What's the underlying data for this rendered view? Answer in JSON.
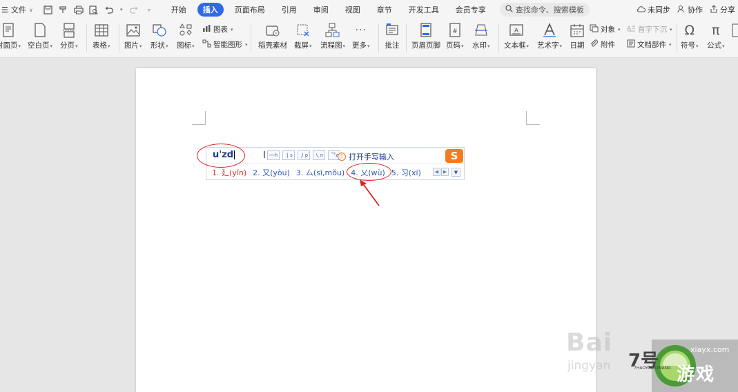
{
  "menubar": {
    "file_label": "文件",
    "tabs": [
      "开始",
      "插入",
      "页面布局",
      "引用",
      "审阅",
      "视图",
      "章节",
      "开发工具",
      "会员专享"
    ],
    "active_tab": "插入",
    "search_placeholder": "查找命令、搜索模板",
    "sync_label": "未同步",
    "collab_label": "协作",
    "share_label": "分享"
  },
  "ribbon": {
    "cover": "封面页",
    "blank": "空白页",
    "pagebreak": "分页",
    "table": "表格",
    "picture": "图片",
    "shape": "形状",
    "icon": "图标",
    "chart": "图表",
    "smartart": "智能图形",
    "daoke": "稻壳素材",
    "screenshot": "截屏",
    "flowchart": "流程图",
    "more": "更多",
    "comment": "批注",
    "header_footer": "页眉页脚",
    "page_number": "页码",
    "watermark": "水印",
    "textbox": "文本框",
    "wordart": "艺术字",
    "date": "日期",
    "object": "对象",
    "attachment": "附件",
    "dropcap": "首字下沉",
    "docparts": "文档部件",
    "symbol": "符号",
    "formula": "公式"
  },
  "ime": {
    "input": "u'zd",
    "stroke_keys": [
      "h",
      "s",
      "p",
      "n",
      "z"
    ],
    "handwriting_label": "打开手写输入",
    "candidates": [
      "1. 廴(yǐn)",
      "2. 又(yòu)",
      "3. 厶(sī,mǒu)",
      "4. 乂(wù)",
      "5. 习(xí)"
    ],
    "logo_letter": "S"
  },
  "watermarks": {
    "baidu": "Bai",
    "jingyan": "jingyan",
    "site_url": "xiayx.com",
    "site_game": "游戏",
    "site_num": "7号",
    "site_small": "7HAOYOUXIWANG"
  },
  "colors": {
    "accent": "#2e6ae8",
    "annotation": "#e02020",
    "ime_text": "#2c58b7",
    "ime_first": "#e0302b",
    "sogou": "#f47b20"
  }
}
